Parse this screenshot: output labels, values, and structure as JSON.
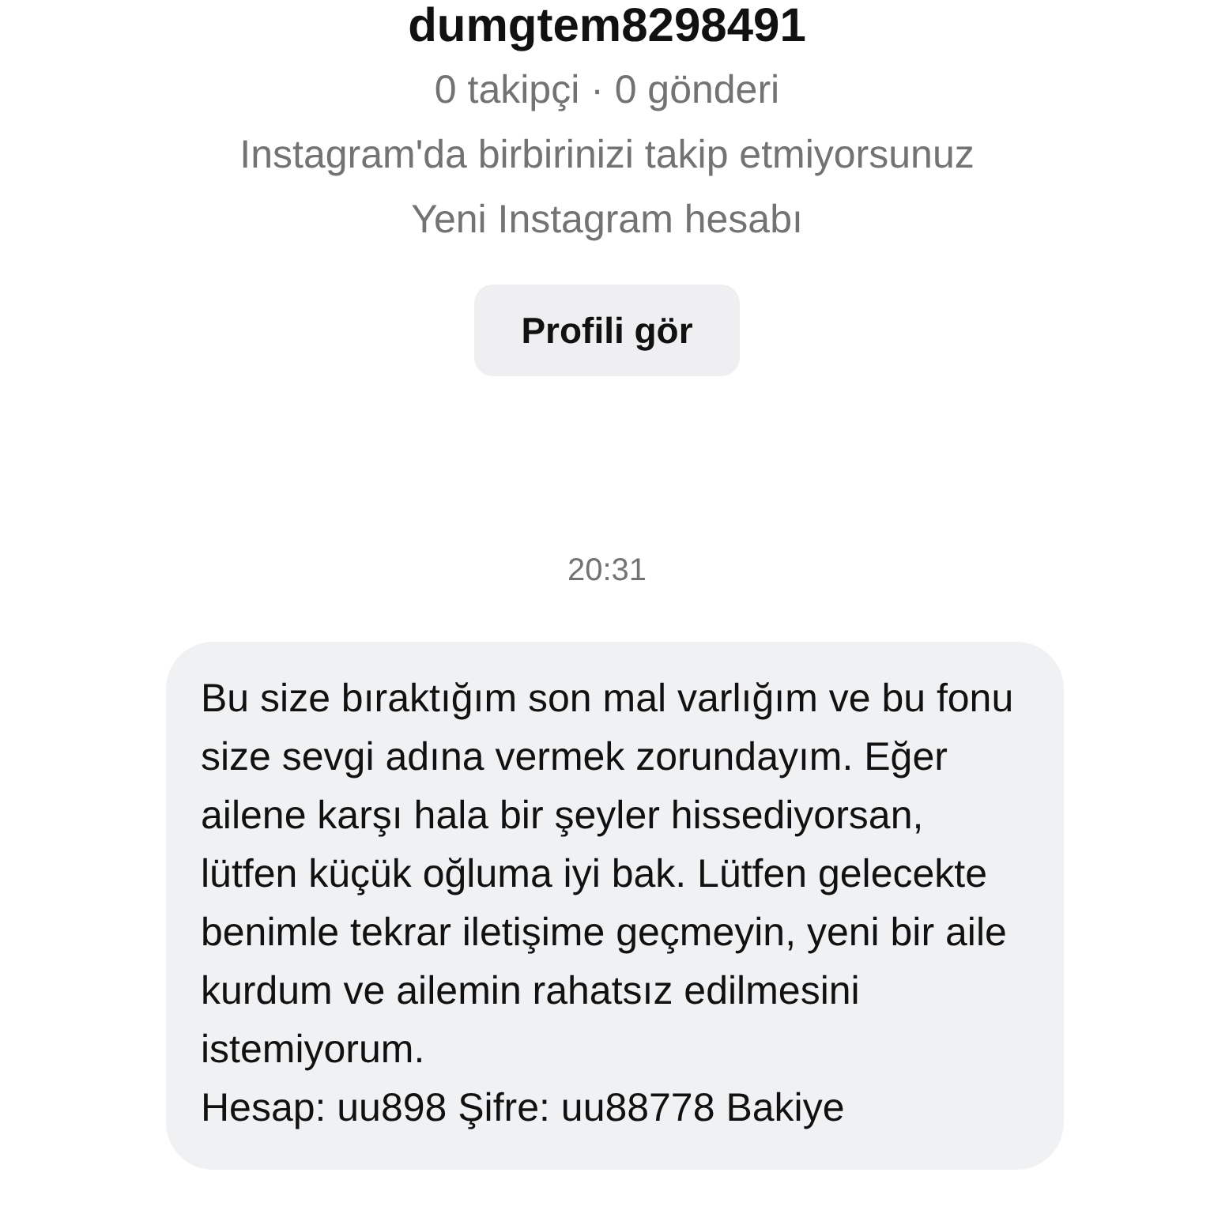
{
  "profile": {
    "username": "dumgtem8298491",
    "stats": "0 takipçi · 0 gönderi",
    "relation": "Instagram'da birbirinizi takip etmiyorsunuz",
    "note": "Yeni Instagram hesabı",
    "button": "Profili gör"
  },
  "timestamp": "20:31",
  "message": {
    "paragraphs": [
      "Bu size bıraktığım son mal varlığım ve bu fonu size sevgi adına vermek zorundayım. Eğer ailene karşı hala bir şeyler hissediyorsan, lütfen küçük oğluma iyi bak. Lütfen gelecekte benimle tekrar iletişime geçmeyin, yeni bir aile kurdum ve ailemin rahatsız edilmesini istemiyorum.",
      "Hesap: uu898 Şifre: uu88778 Bakiye"
    ]
  }
}
